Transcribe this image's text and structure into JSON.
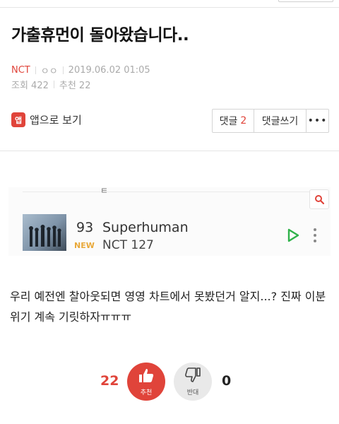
{
  "post": {
    "title": "가출휴먼이 돌아왔습니다..",
    "category": "NCT",
    "author_mask": "ㅇㅇ",
    "datetime": "2019.06.02 01:05",
    "views": "조회 422",
    "recommends": "추천 22"
  },
  "actions": {
    "app_view": "앱으로 보기",
    "app_icon_text": "앱",
    "comment_label": "댓글",
    "comment_count": "2",
    "write_comment": "댓글쓰기",
    "more": "•••"
  },
  "embed": {
    "fragment": "ㅌ",
    "rank": "93",
    "badge": "NEW",
    "song": "Superhuman",
    "artist": "NCT 127",
    "colors": {
      "play": "#2fb24a",
      "search": "#e0443a",
      "badge": "#e9a93a"
    }
  },
  "body": {
    "text": "우리 예전엔 찰아웃되면 영영 차트에서 못봤던거 알지...? 진짜 이분위기 계속 기릿하자ㅠㅠㅠ"
  },
  "vote": {
    "up_count": "22",
    "up_label": "추천",
    "down_label": "반대",
    "down_count": "0"
  },
  "colors": {
    "accent": "#e0443a",
    "text": "#222222",
    "muted": "#aaaaaa"
  }
}
